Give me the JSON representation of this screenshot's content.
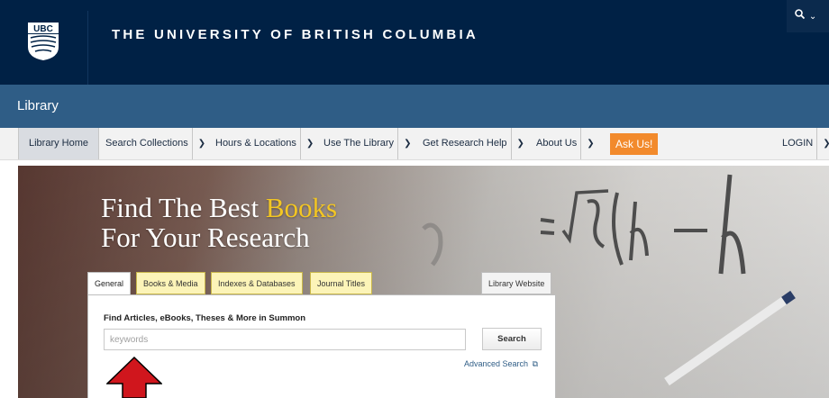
{
  "header": {
    "logo_text": "UBC",
    "university_name": "THE UNIVERSITY OF BRITISH COLUMBIA",
    "search_toggle": {
      "icon": "search-icon",
      "chevron": "chevron-down-icon"
    }
  },
  "library_bar": {
    "title": "Library"
  },
  "nav": {
    "items": [
      {
        "label": "Library Home",
        "has_dropdown": false,
        "active": true
      },
      {
        "label": "Search Collections",
        "has_dropdown": true
      },
      {
        "label": "Hours & Locations",
        "has_dropdown": true
      },
      {
        "label": "Use The Library",
        "has_dropdown": true
      },
      {
        "label": "Get Research Help",
        "has_dropdown": true
      },
      {
        "label": "About Us",
        "has_dropdown": true
      }
    ],
    "ask_us": "Ask Us!",
    "login": "LOGIN"
  },
  "hero": {
    "line1_prefix": "Find The Best ",
    "line1_highlight": "Books",
    "line2": "For Your Research",
    "highlight_color": "#f3c623"
  },
  "search": {
    "tabs": [
      "General",
      "Books & Media",
      "Indexes & Databases",
      "Journal Titles"
    ],
    "library_website_tab": "Library Website",
    "panel_title": "Find Articles, eBooks, Theses & More in Summon",
    "placeholder": "keywords",
    "button": "Search",
    "advanced": "Advanced Search"
  },
  "colors": {
    "header_bg": "#002145",
    "library_bar_bg": "#2f5d86",
    "ask_us_bg": "#f28a2c",
    "arrow": "#d0161d"
  }
}
